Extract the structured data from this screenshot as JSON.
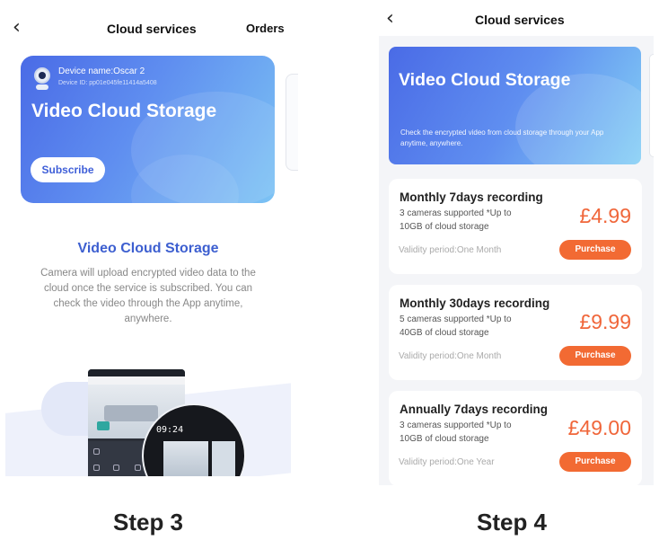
{
  "step3": {
    "header": {
      "back_icon": "chevron-left-icon",
      "title": "Cloud services",
      "orders": "Orders"
    },
    "hero": {
      "device_name": "Device name:Oscar 2",
      "device_id": "Device ID: pp01e045fe11414a5408",
      "title": "Video Cloud Storage",
      "subscribe": "Subscribe",
      "camera_icon": "camera-icon"
    },
    "section": {
      "title": "Video Cloud Storage",
      "description": "Camera will upload encrypted video data to the cloud once the service is subscribed. You can check the video through the App anytime, anywhere."
    },
    "illustration": {
      "time": "09:24"
    },
    "step_label": "Step 3"
  },
  "step4": {
    "header": {
      "back_icon": "chevron-left-icon",
      "title": "Cloud services"
    },
    "hero": {
      "title": "Video Cloud Storage",
      "description": "Check the encrypted video from cloud storage through your App anytime, anywhere."
    },
    "plans": [
      {
        "name": "Monthly 7days recording",
        "line1": "3 cameras supported *Up to",
        "line2": "10GB of cloud storage",
        "validity": "Validity period:One Month",
        "price": "£4.99",
        "button": "Purchase"
      },
      {
        "name": "Monthly 30days recording",
        "line1": "5 cameras supported *Up to",
        "line2": "40GB of cloud storage",
        "validity": "Validity period:One Month",
        "price": "£9.99",
        "button": "Purchase"
      },
      {
        "name": "Annually 7days recording",
        "line1": "3 cameras supported *Up to",
        "line2": "10GB of cloud storage",
        "validity": "Validity period:One Year",
        "price": "£49.00",
        "button": "Purchase"
      }
    ],
    "step_label": "Step 4"
  },
  "colors": {
    "accent_blue": "#3d5fd0",
    "price_orange": "#f0663a",
    "button_orange": "#f26a33"
  }
}
